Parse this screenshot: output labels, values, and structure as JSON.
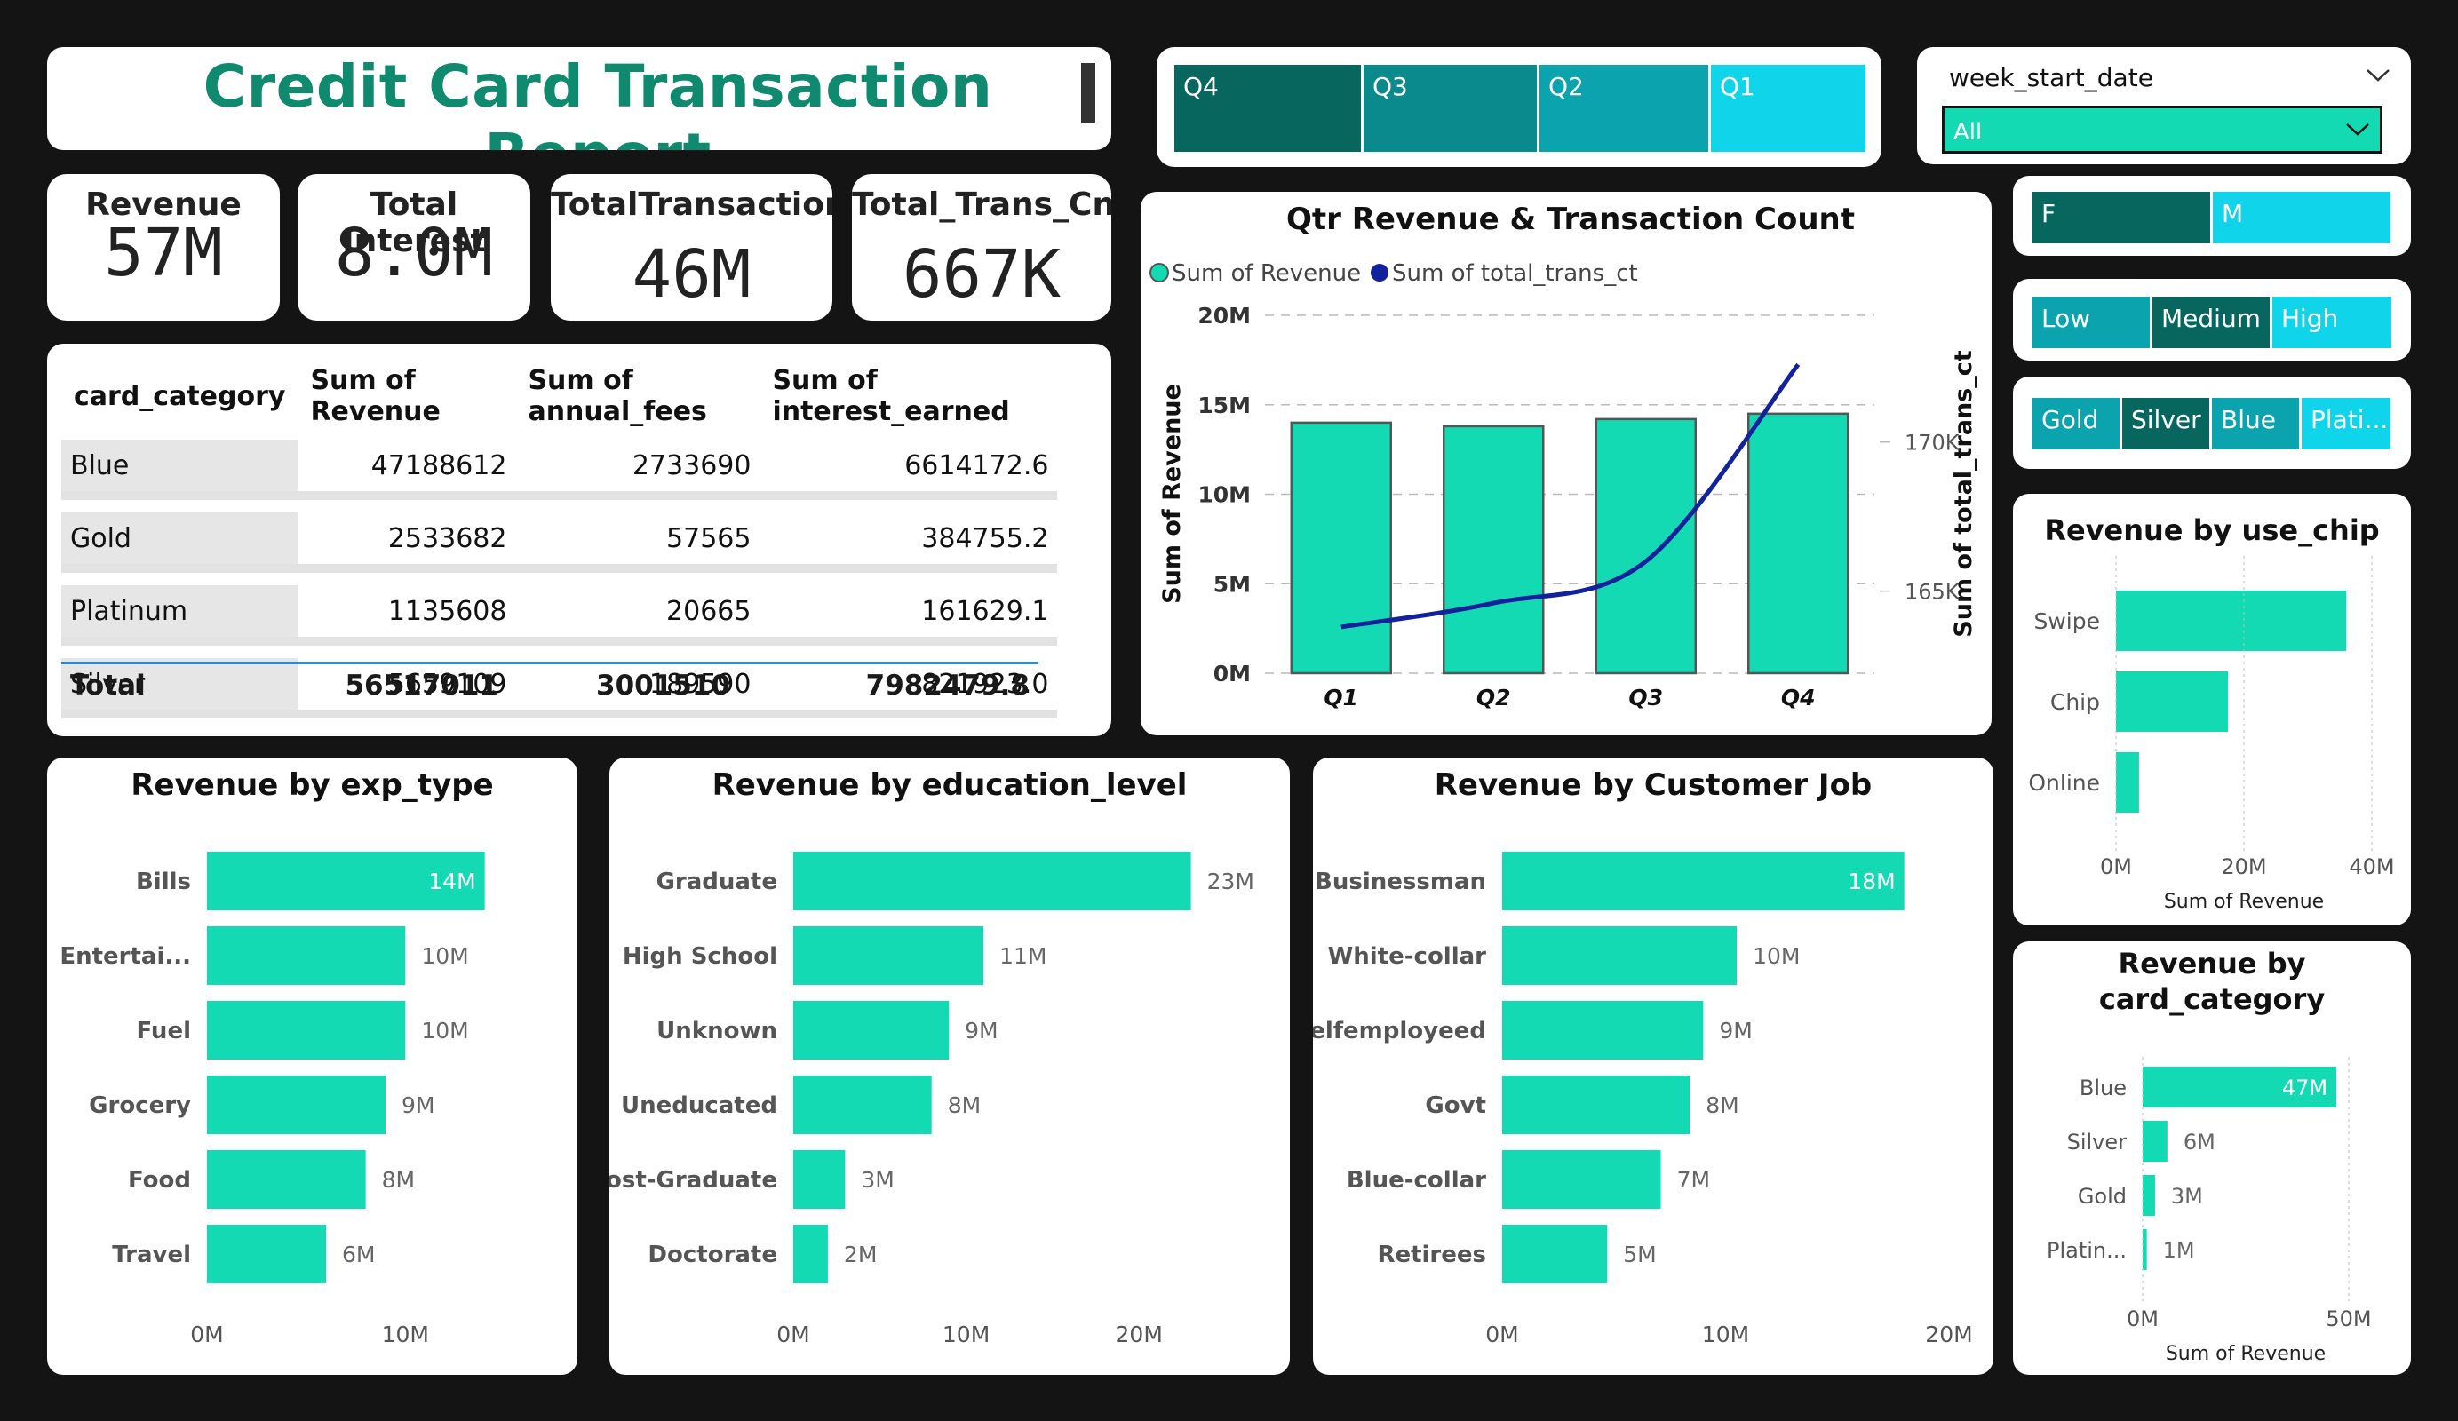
{
  "report_title": "Credit Card Transaction Report",
  "kpis": [
    {
      "label": "Revenue",
      "value": "57M"
    },
    {
      "label": "Total Interest",
      "value": "8.0M"
    },
    {
      "label": "TotalTransaction",
      "value": "46M"
    },
    {
      "label": "Total_Trans_Cnt",
      "value": "667K"
    }
  ],
  "quarter_slicer": [
    "Q4",
    "Q3",
    "Q2",
    "Q1"
  ],
  "week_filter": {
    "label": "week_start_date",
    "value": "All"
  },
  "gender_slicer": [
    "F",
    "M"
  ],
  "income_slicer": [
    "Low",
    "Medium",
    "High"
  ],
  "card_slicer": [
    "Gold",
    "Silver",
    "Blue",
    "Plati..."
  ],
  "table": {
    "headers": [
      "card_category",
      "Sum of Revenue",
      "Sum of annual_fees",
      "Sum of interest_earned"
    ],
    "rows": [
      {
        "cat": "Blue",
        "rev": "47188612",
        "fees": "2733690",
        "interest": "6614172.6"
      },
      {
        "cat": "Gold",
        "rev": "2533682",
        "fees": "57565",
        "interest": "384755.2"
      },
      {
        "cat": "Platinum",
        "rev": "1135608",
        "fees": "20665",
        "interest": "161629.1"
      },
      {
        "cat": "Silver",
        "rev": "5659109",
        "fees": "189590",
        "interest": "821923.0"
      }
    ],
    "total": {
      "label": "Total",
      "rev": "56517011",
      "fees": "3001510",
      "interest": "7982479.8"
    }
  },
  "colors": {
    "accent": "#13dab2",
    "dark_teal": "#07675f",
    "mid_teal": "#0aa3ae",
    "light_cyan": "#10d4ea",
    "line": "#11229c",
    "title_green": "#0f8a6e"
  },
  "chart_data": [
    {
      "type": "bar+line",
      "id": "qtr",
      "title": "Qtr Revenue & Transaction Count",
      "legend": [
        "Sum of Revenue",
        "Sum of total_trans_ct"
      ],
      "categories": [
        "Q1",
        "Q2",
        "Q3",
        "Q4"
      ],
      "series": [
        {
          "name": "Sum of Revenue",
          "values": [
            14.0,
            13.8,
            14.2,
            14.5
          ],
          "unit": "M"
        },
        {
          "name": "Sum of total_trans_ct",
          "values": [
            163800,
            164600,
            166000,
            172600
          ]
        }
      ],
      "ylabel": "Sum of Revenue",
      "y2label": "Sum of total_trans_ct",
      "y_ticks": [
        "0M",
        "5M",
        "10M",
        "15M",
        "20M"
      ],
      "ylim": [
        0,
        20
      ],
      "y2_ticks": [
        "165K",
        "170K"
      ],
      "y2lim": [
        162250,
        174250
      ]
    },
    {
      "type": "bar",
      "id": "exp",
      "title": "Revenue by exp_type",
      "categories": [
        "Bills",
        "Entertai...",
        "Fuel",
        "Grocery",
        "Food",
        "Travel"
      ],
      "values": [
        14,
        10,
        10,
        9,
        8,
        6
      ],
      "labels": [
        "14M",
        "10M",
        "10M",
        "9M",
        "8M",
        "6M"
      ],
      "x_ticks": [
        "0M",
        "10M"
      ],
      "xlim": [
        0,
        15
      ]
    },
    {
      "type": "bar",
      "id": "edu",
      "title": "Revenue by education_level",
      "categories": [
        "Graduate",
        "High School",
        "Unknown",
        "Uneducated",
        "Post-Graduate",
        "Doctorate"
      ],
      "values": [
        23,
        11,
        9,
        8,
        3,
        2
      ],
      "labels": [
        "23M",
        "11M",
        "9M",
        "8M",
        "3M",
        "2M"
      ],
      "x_ticks": [
        "0M",
        "10M",
        "20M"
      ],
      "xlim": [
        0,
        26
      ]
    },
    {
      "type": "bar",
      "id": "job",
      "title": "Revenue by Customer Job",
      "categories": [
        "Businessman",
        "White-collar",
        "Selfemployeed",
        "Govt",
        "Blue-collar",
        "Retirees"
      ],
      "values": [
        18,
        10.5,
        9,
        8.4,
        7.1,
        4.7
      ],
      "labels": [
        "18M",
        "10M",
        "9M",
        "8M",
        "7M",
        "5M"
      ],
      "x_ticks": [
        "0M",
        "10M",
        "20M"
      ],
      "xlim": [
        0,
        20
      ]
    },
    {
      "type": "bar",
      "id": "chip",
      "title": "Revenue by use_chip",
      "categories": [
        "Swipe",
        "Chip",
        "Online"
      ],
      "values": [
        36,
        17.5,
        3.6
      ],
      "x_ticks": [
        "0M",
        "20M",
        "40M"
      ],
      "xlim": [
        0,
        40
      ],
      "xlabel": "Sum of Revenue"
    },
    {
      "type": "bar",
      "id": "card",
      "title": "Revenue by card_category",
      "categories": [
        "Blue",
        "Silver",
        "Gold",
        "Platin..."
      ],
      "values": [
        47,
        6,
        3,
        1
      ],
      "labels": [
        "47M",
        "6M",
        "3M",
        "1M"
      ],
      "x_ticks": [
        "0M",
        "50M"
      ],
      "xlim": [
        0,
        50
      ],
      "xlabel": "Sum of Revenue"
    }
  ]
}
